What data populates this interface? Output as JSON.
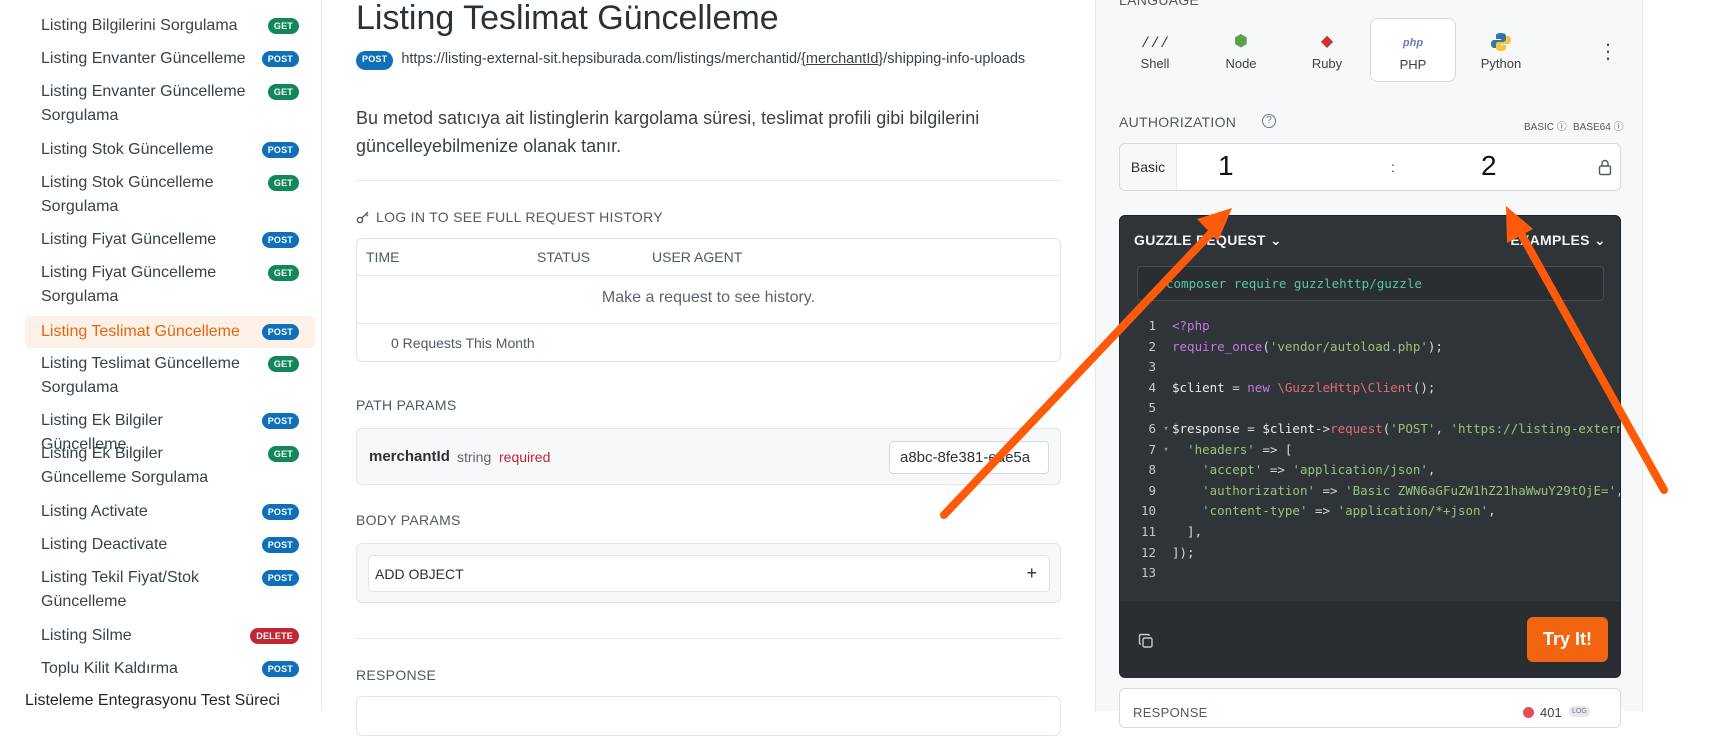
{
  "sidebar": {
    "items": [
      {
        "label": "Listing Bilgilerini Sorgulama",
        "method": "GET"
      },
      {
        "label": "Listing Envanter Güncelleme",
        "method": "POST"
      },
      {
        "label": "Listing Envanter Güncelleme Sorgulama",
        "method": "GET"
      },
      {
        "label": "Listing Stok Güncelleme",
        "method": "POST"
      },
      {
        "label": "Listing Stok Güncelleme Sorgulama",
        "method": "GET"
      },
      {
        "label": "Listing Fiyat Güncelleme",
        "method": "POST"
      },
      {
        "label": "Listing Fiyat Güncelleme Sorgulama",
        "method": "GET"
      },
      {
        "label": "Listing Teslimat Güncelleme",
        "method": "POST"
      },
      {
        "label": "Listing Teslimat Güncelleme Sorgulama",
        "method": "GET"
      },
      {
        "label": "Listing Ek Bilgiler Güncelleme",
        "method": "POST"
      },
      {
        "label": "Listing Ek Bilgiler Güncelleme Sorgulama",
        "method": "GET"
      },
      {
        "label": "Listing Activate",
        "method": "POST"
      },
      {
        "label": "Listing Deactivate",
        "method": "POST"
      },
      {
        "label": "Listing Tekil Fiyat/Stok Güncelleme",
        "method": "POST"
      },
      {
        "label": "Listing Silme",
        "method": "DELETE"
      },
      {
        "label": "Toplu Kilit Kaldırma",
        "method": "POST"
      }
    ],
    "section": "Listeleme Entegrasyonu Test Süreci"
  },
  "main": {
    "title": "Listing Teslimat Güncelleme",
    "method": "POST",
    "url_prefix": "https://listing-external-sit.hepsiburada.com/listings/merchantid/",
    "url_param": "{merchantId}",
    "url_suffix": "/shipping-info-uploads",
    "description": "Bu metod satıcıya ait listinglerin kargolama süresi, teslimat profili gibi bilgilerini güncelleyebilmenize olanak tanır.",
    "history_title": "LOG IN TO SEE FULL REQUEST HISTORY",
    "history_cols": [
      "TIME",
      "STATUS",
      "USER AGENT"
    ],
    "history_empty": "Make a request to see history.",
    "history_count": "0 Requests This Month",
    "path_params_title": "PATH PARAMS",
    "param_name": "merchantId",
    "param_type": "string",
    "param_required": "required",
    "param_value": "a8bc-8fe381-eae5a",
    "body_params_title": "BODY PARAMS",
    "add_object": "ADD OBJECT",
    "response_title": "RESPONSE"
  },
  "right": {
    "language_title": "LANGUAGE",
    "languages": [
      "Shell",
      "Node",
      "Ruby",
      "PHP",
      "Python"
    ],
    "active_language": "PHP",
    "auth_title": "AUTHORIZATION",
    "auth_modes": [
      "BASIC",
      "BASE64"
    ],
    "auth_scheme": "Basic",
    "auth_user": "1",
    "auth_pass": "2",
    "auth_sep": ":",
    "code_title": "GUZZLE REQUEST",
    "examples_title": "EXAMPLES",
    "install_cmd": "composer require guzzlehttp/guzzle",
    "try_label": "Try It!",
    "response_title": "RESPONSE",
    "response_code": "401",
    "response_log": "LOG"
  },
  "colors": {
    "accent": "#f2640f",
    "get": "#11875a",
    "post": "#0f6fb8",
    "delete": "#c22533",
    "annotation_arrow": "#ff5a0a"
  },
  "icons": [
    "shell-icon",
    "node-icon",
    "ruby-icon",
    "php-icon",
    "python-icon",
    "more-icon",
    "help-icon",
    "info-icon",
    "lock-icon",
    "chevron-down-icon",
    "copy-icon",
    "key-icon",
    "plus-icon"
  ]
}
